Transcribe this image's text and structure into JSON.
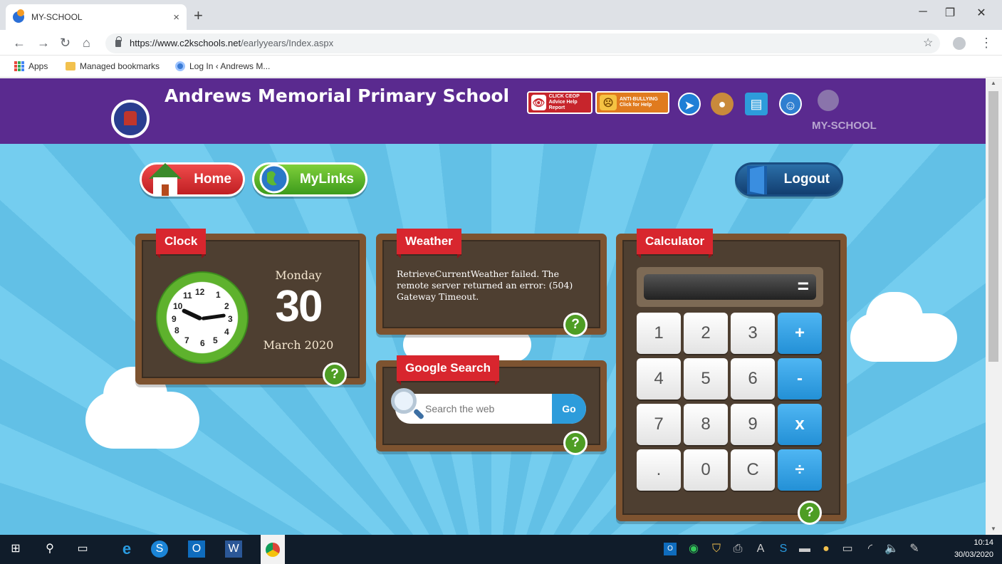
{
  "browser": {
    "tab_title": "MY-SCHOOL",
    "url_host": "https://www.c2kschools.net",
    "url_path": "/earlyyears/Index.aspx",
    "bookmarks": [
      "Apps",
      "Managed bookmarks",
      "Log In ‹ Andrews M..."
    ]
  },
  "header": {
    "school_name": "Andrews Memorial Primary School",
    "ceop_label": "CLICK CEOP",
    "ceop_sub": "Advice Help Report",
    "anti_label": "ANTI-BULLYING",
    "anti_sub": "Click for Help",
    "brand": "MY-SCHOOL"
  },
  "nav": {
    "home": "Home",
    "mylinks": "MyLinks",
    "logout": "Logout"
  },
  "clock": {
    "title": "Clock",
    "day": "Monday",
    "date": "30",
    "month": "March 2020",
    "numbers": [
      "12",
      "1",
      "2",
      "3",
      "4",
      "5",
      "6",
      "7",
      "8",
      "9",
      "10",
      "11"
    ]
  },
  "weather": {
    "title": "Weather",
    "message": "RetrieveCurrentWeather failed. The remote server returned an error: (504) Gateway Timeout."
  },
  "search": {
    "title": "Google Search",
    "placeholder": "Search the web",
    "go": "Go"
  },
  "calculator": {
    "title": "Calculator",
    "display": "=",
    "keys": [
      "1",
      "2",
      "3",
      "+",
      "4",
      "5",
      "6",
      "-",
      "7",
      "8",
      "9",
      "x",
      ".",
      "0",
      "C",
      "÷"
    ]
  },
  "help": "?",
  "taskbar": {
    "time": "10:14",
    "date": "30/03/2020"
  }
}
